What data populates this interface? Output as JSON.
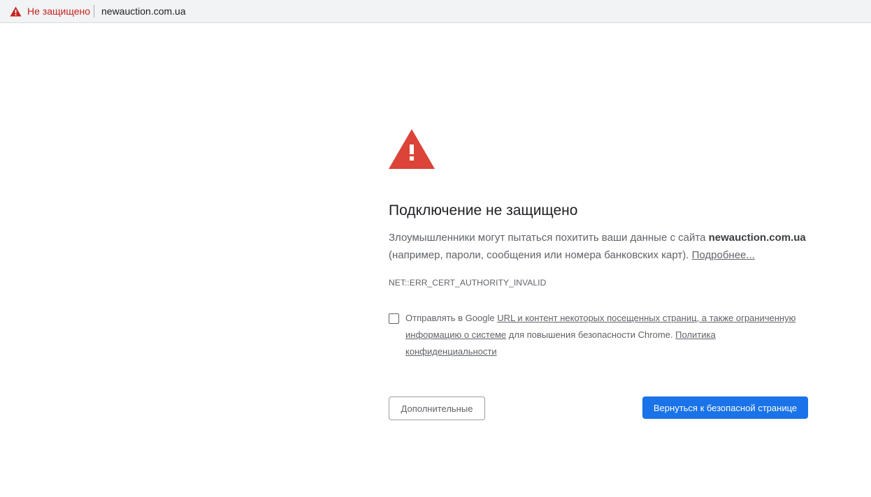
{
  "addressbar": {
    "security_label": "Не защищено",
    "url": "newauction.com.ua",
    "security_icon": "warning-triangle-icon",
    "security_color": "#c5221f"
  },
  "interstitial": {
    "icon": "warning-triangle-icon",
    "icon_color": "#db4437",
    "title": "Подключение не защищено",
    "desc_prefix": "Злоумышленники могут пытаться похитить ваши данные с сайта ",
    "desc_domain": "newauction.com.ua",
    "desc_suffix": " (например, пароли, сообщения или номера банковских карт). ",
    "desc_more_link": "Подробнее...",
    "error_code": "NET::ERR_CERT_AUTHORITY_INVALID"
  },
  "optin": {
    "checked": false,
    "text_prefix": "Отправлять в Google ",
    "link_url_content": "URL и контент некоторых посещенных страниц, а также ограниченную информацию о системе",
    "text_middle": " для повышения безопасности Chrome. ",
    "link_privacy": "Политика конфиденциальности"
  },
  "buttons": {
    "advanced": "Дополнительные",
    "back_to_safety": "Вернуться к безопасной странице",
    "primary_color": "#1a73e8"
  }
}
